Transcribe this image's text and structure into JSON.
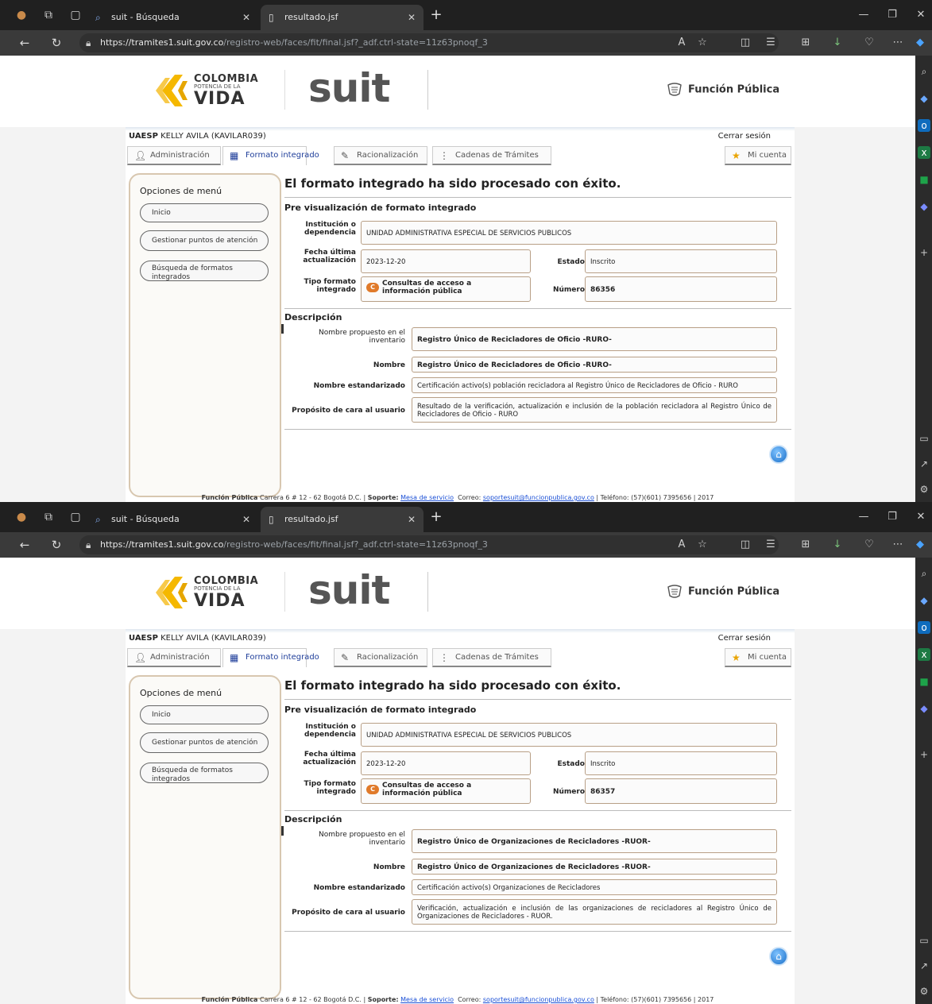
{
  "browser": {
    "tabs": [
      {
        "label": "suit - Búsqueda",
        "icon": "search-icon"
      },
      {
        "label": "resultado.jsf",
        "icon": "document-icon"
      }
    ],
    "url_domain": "https://tramites1.suit.gov.co",
    "url_path": "/registro-web/faces/fit/final.jsf?_adf.ctrl-state=11z63pnoqf_3"
  },
  "header": {
    "logo_colombia_1": "COLOMBIA",
    "logo_colombia_2": "POTENCIA DE LA",
    "logo_colombia_3": "VIDA",
    "suit_logo": "suit",
    "fp_logo": "Función Pública"
  },
  "user": {
    "entity": "UAESP",
    "name": "KELLY AVILA (KAVILAR039)",
    "logout": "Cerrar sesión"
  },
  "menu": {
    "admin": "Administración",
    "formato": "Formato integrado",
    "racionalizacion": "Racionalización",
    "cadenas": "Cadenas de Trámites",
    "cuenta": "Mi cuenta"
  },
  "sidebar": {
    "title": "Opciones de menú",
    "items": [
      "Inicio",
      "Gestionar puntos de atención",
      "Búsqueda de formatos integrados"
    ]
  },
  "labels": {
    "success": "El formato integrado ha sido procesado con éxito.",
    "preview": "Pre visualización de formato integrado",
    "institucion": "Institución o dependencia",
    "fecha": "Fecha última actualización",
    "estado": "Estado",
    "tipo": "Tipo formato integrado",
    "numero": "Número",
    "descripcion": "Descripción",
    "nombre_propuesto": "Nombre propuesto en el inventario",
    "nombre": "Nombre",
    "nombre_estandarizado": "Nombre estandarizado",
    "proposito": "Propósito de cara al usuario"
  },
  "footer": {
    "org": "Función Pública",
    "address": " Carrera 6 # 12 - 62 Bogotá D.C. | ",
    "soporte_label": "Soporte:",
    "mesa": "Mesa de servicio",
    "correo_label": "Correo:",
    "email": "soportesuit@funcionpublica.gov.co",
    "telefono": " | Teléfono: (57)(601) 7395656 | 2017"
  },
  "records": [
    {
      "institucion": "UNIDAD ADMINISTRATIVA ESPECIAL DE SERVICIOS PUBLICOS",
      "fecha": "2023-12-20",
      "estado": "Inscrito",
      "tipo_badge": "C",
      "tipo": "Consultas de acceso a información pública",
      "numero": "86356",
      "nombre_propuesto": "Registro Único de Recicladores de Oficio -RURO-",
      "nombre": "Registro Único de Recicladores de Oficio -RURO-",
      "nombre_estandarizado": "Certificación activo(s) población recicladora al Registro Único de Recicladores de Oficio - RURO",
      "proposito": "Resultado de la verificación, actualización e inclusión de la población recicladora al Registro Único de Recicladores de Oficio - RURO"
    },
    {
      "institucion": "UNIDAD ADMINISTRATIVA ESPECIAL DE SERVICIOS PUBLICOS",
      "fecha": "2023-12-20",
      "estado": "Inscrito",
      "tipo_badge": "C",
      "tipo": "Consultas de acceso a información pública",
      "numero": "86357",
      "nombre_propuesto": "Registro Único de Organizaciones de Recicladores -RUOR-",
      "nombre": "Registro Único de Organizaciones de Recicladores -RUOR-",
      "nombre_estandarizado": "Certificación activo(s) Organizaciones de Recicladores",
      "proposito": "Verificación, actualización e inclusión de las organizaciones de recicladores al Registro Único de Organizaciones de Recicladores - RUOR."
    }
  ]
}
